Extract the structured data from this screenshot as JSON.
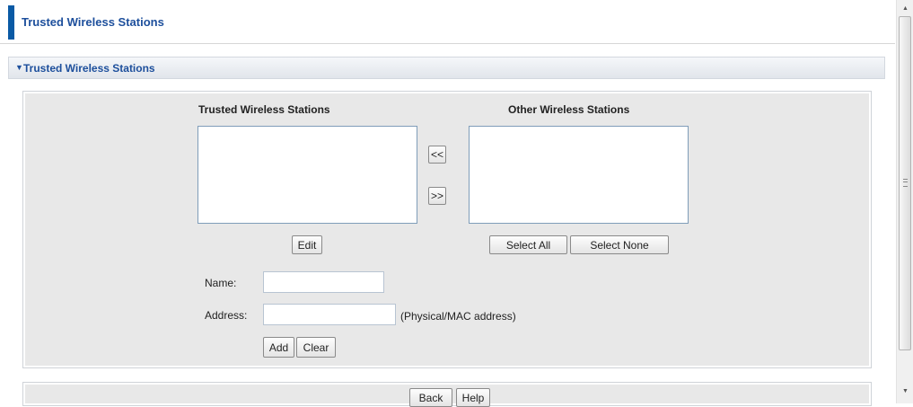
{
  "header": {
    "title": "Trusted Wireless Stations"
  },
  "section": {
    "title": "Trusted Wireless Stations",
    "arrow": "▼"
  },
  "lists": {
    "trusted_title": "Trusted Wireless Stations",
    "other_title": "Other Wireless Stations"
  },
  "transfer": {
    "left_label": "<<",
    "right_label": ">>"
  },
  "buttons": {
    "edit": "Edit",
    "select_all": "Select All",
    "select_none": "Select None",
    "add": "Add",
    "clear": "Clear"
  },
  "form": {
    "name_label": "Name:",
    "name_value": "",
    "address_label": "Address:",
    "address_value": "",
    "address_hint": "(Physical/MAC address)"
  },
  "footer": {
    "back": "Back",
    "help": "Help"
  },
  "scrollbar": {
    "up": "▲",
    "down": "▼"
  },
  "colors": {
    "accent": "#0a5aa5",
    "title": "#1d4f9c",
    "panel": "#e8e8e8"
  }
}
